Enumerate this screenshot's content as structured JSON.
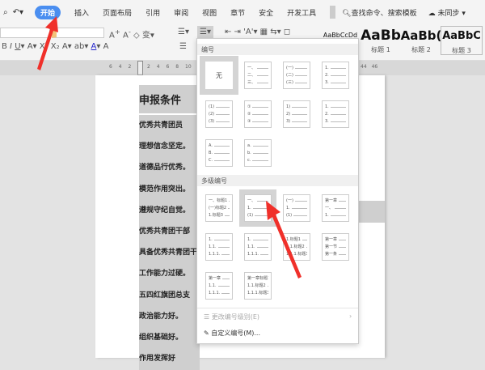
{
  "tabs": {
    "start_icons": [
      "preview-icon",
      "undo-icon"
    ],
    "items": [
      "开始",
      "插入",
      "页面布局",
      "引用",
      "审阅",
      "视图",
      "章节",
      "安全",
      "开发工具"
    ],
    "search": "查找命令、搜索模板",
    "sync": "未同步"
  },
  "toolbar": {
    "styles": [
      {
        "sample": "AaBbCcDd",
        "label": ""
      },
      {
        "sample": "AaBb",
        "label": "标题 1"
      },
      {
        "sample": "AaBb(",
        "label": "标题 2"
      },
      {
        "sample": "AaBbC",
        "label": "标题 3"
      }
    ]
  },
  "ruler": {
    "left": [
      "6",
      "4",
      "2"
    ],
    "right": [
      "2",
      "4",
      "6",
      "8",
      "10"
    ],
    "far": [
      "44",
      "46"
    ]
  },
  "document": {
    "lines": [
      "申报条件",
      "优秀共青团员",
      "理想信念坚定。",
      "道德品行优秀。",
      "模范作用突出。",
      "遵规守纪自觉。",
      "优秀共青团干部",
      "具备优秀共青团干",
      "工作能力过硬。",
      "五四红旗团总支",
      "政治能力好。",
      "组织基础好。",
      "作用发挥好"
    ]
  },
  "dropdown": {
    "numbering_title": "编号",
    "none_label": "无",
    "numbering": [
      [
        "一、",
        "二、",
        "三、"
      ],
      [
        "(一)",
        "(二)",
        "(三)"
      ],
      [
        "1.",
        "2.",
        "3."
      ],
      [
        "(1)",
        "(2)",
        "(3)"
      ],
      [
        "①",
        "②",
        "③"
      ],
      [
        "1)",
        "2)",
        "3)"
      ],
      [
        "1.",
        "2.",
        "3."
      ],
      [
        "A.",
        "B.",
        "C."
      ],
      [
        "a.",
        "b.",
        "c."
      ]
    ],
    "multilevel_title": "多级编号",
    "multilevel": [
      [
        "一、标题1",
        "(一)标题2",
        "  1.标题3"
      ],
      [
        "一、",
        "  1.",
        "(1)"
      ],
      [
        "(一)",
        "  1.",
        "(1)"
      ],
      [
        "第一章",
        "一、",
        "1."
      ],
      [
        "1.",
        "1.1.",
        "1.1.1."
      ],
      [
        "1.",
        "  1.1.",
        "    1.1.1."
      ],
      [
        "1.标题1",
        "1.1.标题2",
        "1.1.1.标题3"
      ],
      [
        "第一章",
        "第一节",
        "第一条"
      ],
      [
        "第一章",
        "1.1.",
        "1.1.1."
      ],
      [
        "第一章标题1",
        "1.1.标题2",
        "1.1.1.标题3"
      ]
    ],
    "change_level": "更改编号级别(E)",
    "custom": "自定义编号(M)..."
  }
}
